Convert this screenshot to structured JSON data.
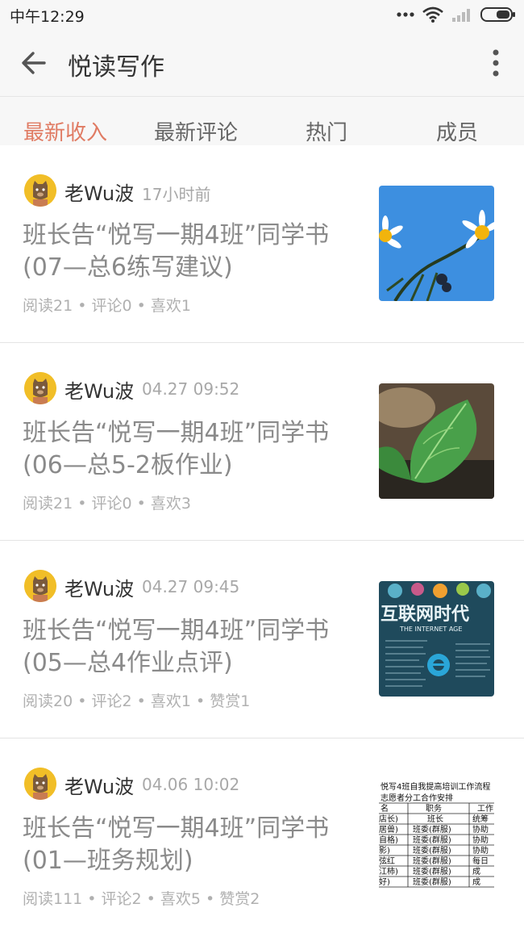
{
  "status_bar": {
    "time": "中午12:29"
  },
  "header": {
    "title": "悦读写作"
  },
  "tabs": [
    {
      "label": "最新收入",
      "active": true
    },
    {
      "label": "最新评论",
      "active": false
    },
    {
      "label": "热门",
      "active": false
    },
    {
      "label": "成员",
      "active": false
    }
  ],
  "posts": [
    {
      "author": "老Wu波",
      "time": "17小时前",
      "title": "班长告“悦写一期4班”同学书(07—总6练写建议)",
      "stats": "阅读21 • 评论0 • 喜欢1",
      "thumbnail": "daisy-flowers-blue-sky"
    },
    {
      "author": "老Wu波",
      "time": "04.27 09:52",
      "title": "班长告“悦写一期4班”同学书(06—总5-2板作业)",
      "stats": "阅读21 • 评论0 • 喜欢3",
      "thumbnail": "green-leaf"
    },
    {
      "author": "老Wu波",
      "time": "04.27 09:45",
      "title": "班长告“悦写一期4班”同学书(05—总4作业点评)",
      "stats": "阅读20 • 评论2 • 喜欢1 • 赞赏1",
      "thumbnail": "internet-age-poster",
      "thumb_text": {
        "headline": "互联网时代",
        "sub": "THE INTERNET AGE"
      }
    },
    {
      "author": "老Wu波",
      "time": "04.06 10:02",
      "title": "班长告“悦写一期4班”同学书(01—班务规划)",
      "stats": "阅读111 • 评论2 • 喜欢5 • 赞赏2",
      "thumbnail": "duty-table",
      "thumb_text": {
        "title": "悦写4班自我提高培训工作流程",
        "subtitle": "志愿者分工合作安排",
        "headers": [
          "名",
          "职务",
          "工作"
        ],
        "rows": [
          [
            "店长)",
            "班长",
            "统筹"
          ],
          [
            "居兽)",
            "班委(群服)",
            "协助"
          ],
          [
            "自格)",
            "班委(群服)",
            "协助"
          ],
          [
            "影)",
            "班委(群服)",
            "协助"
          ],
          [
            "弦红",
            "班委(群服)",
            "每日"
          ],
          [
            "江柿)",
            "班委(群服)",
            "成"
          ],
          [
            "好)",
            "班委(群服)",
            "成"
          ]
        ]
      }
    }
  ],
  "colors": {
    "accent": "#e07b63",
    "bar_bg": "#f7f7f7",
    "title_text": "#8a8a8a",
    "meta_text": "#b0b0b0"
  }
}
